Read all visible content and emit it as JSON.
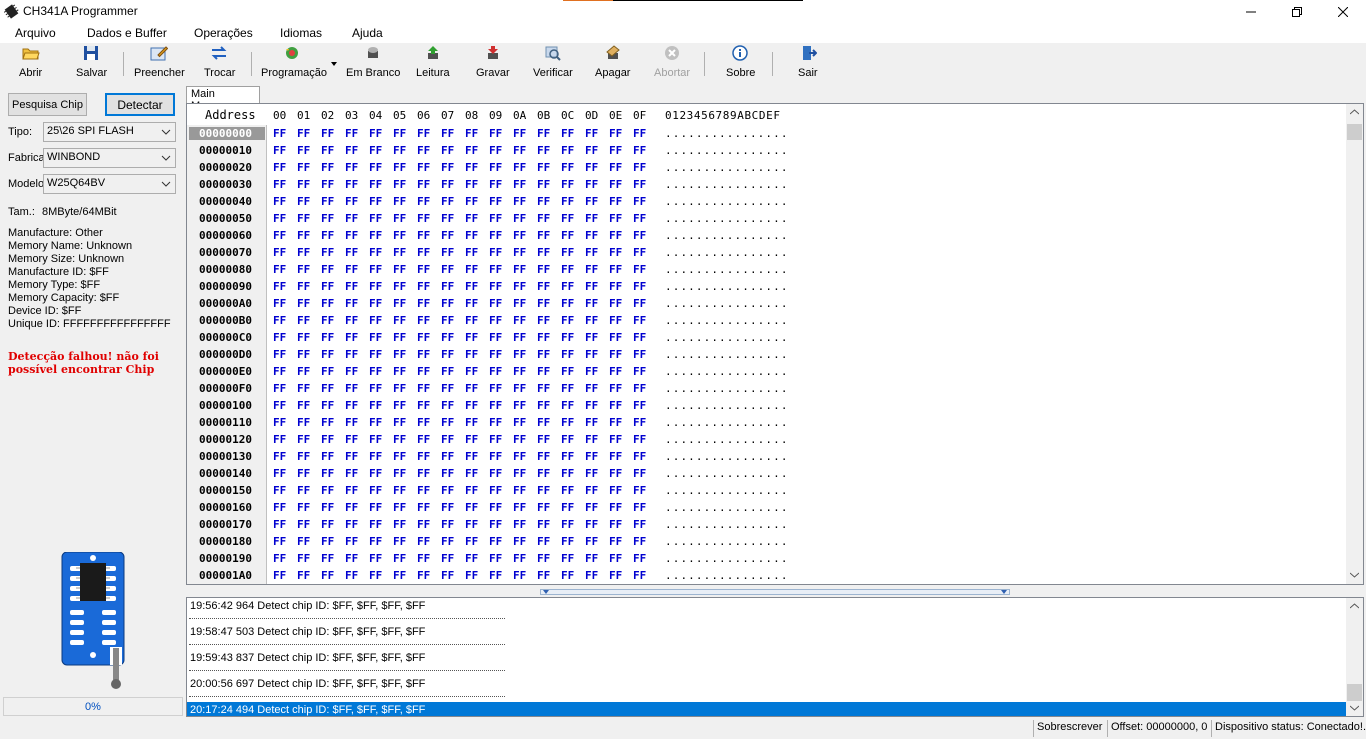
{
  "window": {
    "title": "CH341A Programmer",
    "minimize_icon": "minimize-icon",
    "maximize_icon": "maximize-icon",
    "close_icon": "close-icon"
  },
  "menu": [
    "Arquivo",
    "Dados e Buffer",
    "Operações",
    "Idiomas",
    "Ajuda"
  ],
  "toolbar": {
    "abrir": "Abrir",
    "salvar": "Salvar",
    "preencher": "Preencher",
    "trocar": "Trocar",
    "programacao": "Programação",
    "em_branco": "Em Branco",
    "leitura": "Leitura",
    "gravar": "Gravar",
    "verificar": "Verificar",
    "apagar": "Apagar",
    "abortar": "Abortar",
    "sobre": "Sobre",
    "sair": "Sair"
  },
  "left": {
    "search_chip": "Pesquisa Chip",
    "detect": "Detectar",
    "tipo_label": "Tipo:",
    "tipo_value": "25\\26 SPI FLASH",
    "fabrica_label": "Fabrica",
    "fabrica_value": "WINBOND",
    "modelo_label": "Modelo",
    "modelo_value": "W25Q64BV",
    "size_label": "Tam.:",
    "size_value": "8MByte/64MBit",
    "info": [
      "Manufacture: Other",
      "Memory Name: Unknown",
      "Memory Size: Unknown",
      "Manufacture ID: $FF",
      "Memory Type: $FF",
      "Memory Capacity: $FF",
      "Device ID: $FF",
      "Unique ID: FFFFFFFFFFFFFFFF"
    ],
    "error_line1": "Detecção falhou! não foi",
    "error_line2": "possível encontrar Chip",
    "progress_text": "0%",
    "progress_value": 0
  },
  "hex": {
    "tab_label": "Main Memory",
    "address_header": "Address",
    "columns": [
      "00",
      "01",
      "02",
      "03",
      "04",
      "05",
      "06",
      "07",
      "08",
      "09",
      "0A",
      "0B",
      "0C",
      "0D",
      "0E",
      "0F"
    ],
    "ascii_header": "0123456789ABCDEF",
    "byte_value": "FF",
    "ascii_row": "................",
    "addresses": [
      "00000000",
      "00000010",
      "00000020",
      "00000030",
      "00000040",
      "00000050",
      "00000060",
      "00000070",
      "00000080",
      "00000090",
      "000000A0",
      "000000B0",
      "000000C0",
      "000000D0",
      "000000E0",
      "000000F0",
      "00000100",
      "00000110",
      "00000120",
      "00000130",
      "00000140",
      "00000150",
      "00000160",
      "00000170",
      "00000180",
      "00000190",
      "000001A0"
    ]
  },
  "log": [
    "19:56:42 964 Detect chip ID: $FF, $FF, $FF, $FF",
    "19:58:47 503 Detect chip ID: $FF, $FF, $FF, $FF",
    "19:59:43 837 Detect chip ID: $FF, $FF, $FF, $FF",
    "20:00:56 697 Detect chip ID: $FF, $FF, $FF, $FF",
    "20:17:24 494 Detect chip ID: $FF, $FF, $FF, $FF"
  ],
  "status": {
    "mode": "Sobrescrever",
    "offset": "Offset: 00000000, 0",
    "device": "Dispositivo status: Conectado!."
  }
}
